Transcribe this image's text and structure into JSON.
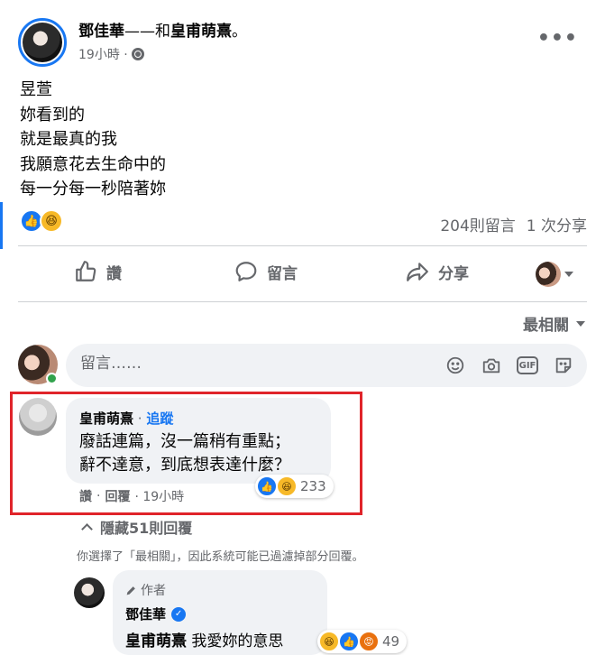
{
  "post": {
    "author": "鄧佳華",
    "with_sep": "——和",
    "tagged": "皇甫萌熹",
    "end_mark": "。",
    "time": "19小時 ·",
    "lines": [
      "昱萱",
      "妳看到的",
      "就是最真的我",
      "我願意花去生命中的",
      "每一分每一秒陪著妳"
    ],
    "reactions": [
      "like",
      "haha"
    ],
    "comments_count": "204則留言",
    "shares_count": "1 次分享"
  },
  "actions": {
    "like": "讚",
    "comment": "留言",
    "share": "分享"
  },
  "sort": {
    "label": "最相關"
  },
  "composer": {
    "placeholder": "留言……"
  },
  "comment1": {
    "author": "皇甫萌熹",
    "sep": " · ",
    "follow": "追蹤",
    "text_line1": "廢話連篇，沒一篇稍有重點；",
    "text_line2": "辭不達意，到底想表達什麼？",
    "like": "讚",
    "sep2": "·",
    "reply": "回覆",
    "time": "· 19小時",
    "reaction_count": "233"
  },
  "hidden_replies": "隱藏51則回覆",
  "filter_note": "你選擇了「最相關」，因此系統可能已過濾掉部分回覆。",
  "reply1": {
    "badge": "作者",
    "author": "鄧佳華",
    "mention": "皇甫萌熹",
    "text": " 我愛妳的意思",
    "reaction_count": "49"
  },
  "colors": {
    "accent": "#1877f2",
    "highlight_box": "#e0242a",
    "bubble": "#f0f2f5",
    "muted": "#65676b"
  },
  "icons": [
    "globe-icon",
    "more-icon",
    "like-icon",
    "comment-icon",
    "share-icon",
    "emoji-icon",
    "camera-icon",
    "gif-icon",
    "sticker-icon",
    "verified-icon",
    "pen-icon"
  ]
}
